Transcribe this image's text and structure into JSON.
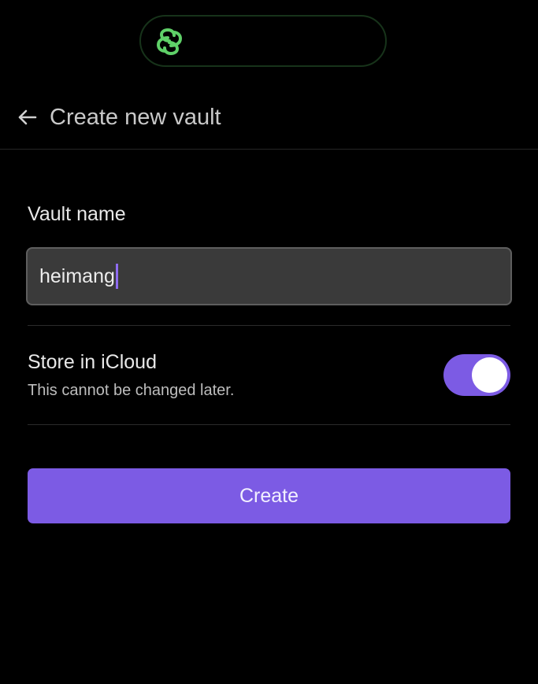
{
  "app": {
    "icon": "link-icon",
    "icon_color": "#5fd068"
  },
  "header": {
    "back_icon": "arrow-left-icon",
    "title": "Create new vault"
  },
  "form": {
    "vault_name_label": "Vault name",
    "vault_name_value": "heimang",
    "icloud_label": "Store in iCloud",
    "icloud_hint": "This cannot be changed later.",
    "icloud_enabled": true,
    "create_label": "Create"
  },
  "colors": {
    "accent": "#7c5be4",
    "background": "#000000",
    "input_background": "#3a3a3a",
    "caret": "#8f6cf0"
  }
}
